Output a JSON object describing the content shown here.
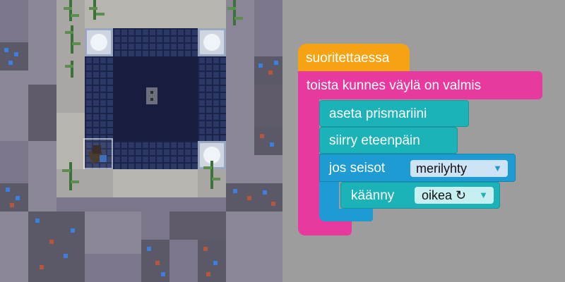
{
  "world": {
    "agent_facing": "down"
  },
  "workspace": {
    "on_start_label": "suoritettaessa",
    "repeat_until_label": "toista kunnes väylä on valmis",
    "place_label": "aseta prismariini",
    "move_label": "siirry eteenpäin",
    "if_label": "jos seisot",
    "if_condition_value": "merilyhty",
    "turn_label": "käänny",
    "turn_direction_value": "oikea ↻",
    "dropdown_arrow": "▼"
  },
  "colors": {
    "event_block": "#f5a313",
    "loop_block": "#e8399e",
    "action_block": "#1bb3b7",
    "logic_block": "#1e9bd3",
    "workspace_bg": "#9d9d9d"
  }
}
